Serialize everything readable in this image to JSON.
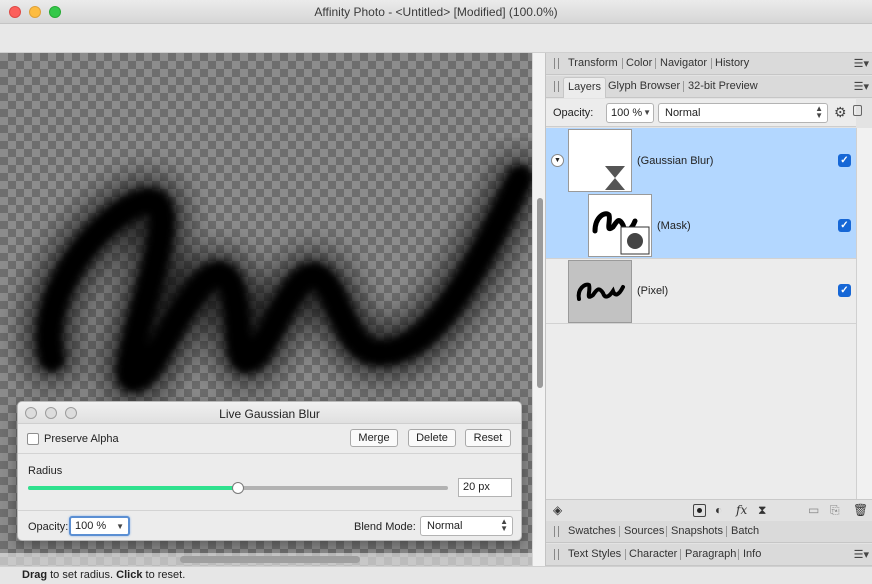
{
  "window": {
    "title": "Affinity Photo - <Untitled> [Modified] (100.0%)"
  },
  "status": {
    "drag": "Drag",
    "drag_text": " to set radius. ",
    "click": "Click",
    "click_text": " to reset."
  },
  "dialog": {
    "title": "Live Gaussian Blur",
    "preserve_alpha": "Preserve Alpha",
    "preserve_alpha_checked": false,
    "merge": "Merge",
    "delete": "Delete",
    "reset": "Reset",
    "radius_label": "Radius",
    "radius_value": "20 px",
    "radius_fraction": 0.5,
    "opacity_label": "Opacity:",
    "opacity_value": "100 %",
    "blend_label": "Blend Mode:",
    "blend_value": "Normal"
  },
  "panels": {
    "top_tabs": [
      "Transform",
      "Color",
      "Navigator",
      "History"
    ],
    "layers_tabs": [
      "Layers",
      "Glyph Browser",
      "32-bit Preview"
    ],
    "bottom_tabs_1": [
      "Swatches",
      "Sources",
      "Snapshots",
      "Batch"
    ],
    "bottom_tabs_2": [
      "Text Styles",
      "Character",
      "Paragraph",
      "Info"
    ]
  },
  "layers": {
    "opacity_label": "Opacity:",
    "opacity_value": "100 %",
    "blend_value": "Normal",
    "items": [
      {
        "name": "(Gaussian Blur)",
        "visible": true,
        "selected": true
      },
      {
        "name": "(Mask)",
        "visible": true,
        "selected": true
      },
      {
        "name": "(Pixel)",
        "visible": true,
        "selected": false
      }
    ]
  },
  "colors": {
    "selection": "#b3d7ff",
    "slider_fill": "#2fe18e",
    "checkbox": "#1667d6"
  },
  "icons": {
    "layers_foot": [
      "layer-stack-icon",
      "mask-icon",
      "adjustment-icon",
      "fx-icon",
      "live-filter-icon",
      "folder-icon",
      "add-layer-icon",
      "trash-icon"
    ]
  }
}
